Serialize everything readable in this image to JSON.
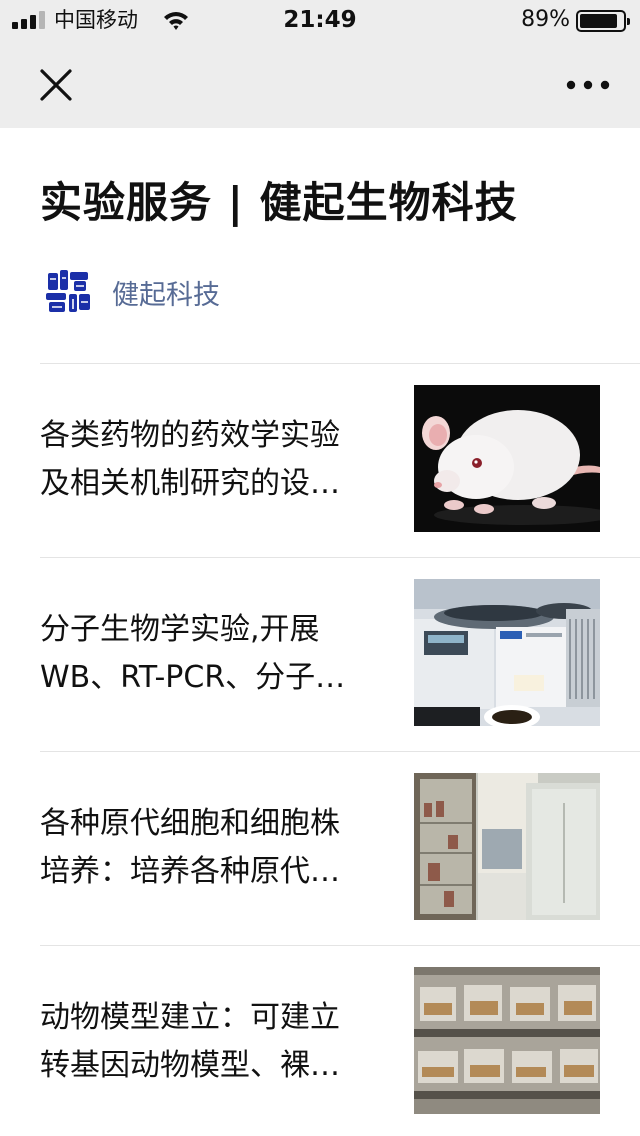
{
  "status_bar": {
    "carrier": "中国移动",
    "time": "21:49",
    "battery_percent": "89%",
    "battery_level": 0.89,
    "icons": [
      "signal-icon",
      "wifi-icon",
      "battery-icon"
    ]
  },
  "nav": {
    "close_icon": "close-icon",
    "more_icon": "more-icon"
  },
  "article": {
    "title": "实验服务 | 健起生物科技",
    "author": "健起科技",
    "avatar_icon": "brand-logo-avatar"
  },
  "items": [
    {
      "line1": "各类药物的药效学实验",
      "line2": "及相关机制研究的设…",
      "image": "white-mouse-photo"
    },
    {
      "line1": "分子生物学实验,开展",
      "line2": "WB、RT-PCR、分子…",
      "image": "centrifuge-photo"
    },
    {
      "line1": "各种原代细胞和细胞株",
      "line2": "培养：培养各种原代…",
      "image": "cell-culture-lab-photo"
    },
    {
      "line1": "动物模型建立：可建立",
      "line2": "转基因动物模型、裸…",
      "image": "animal-cages-photo"
    }
  ],
  "colors": {
    "bar_background": "#ededed",
    "link": "#576b95",
    "divider": "#e4e4e4",
    "logo_blue": "#1b2fa8"
  }
}
